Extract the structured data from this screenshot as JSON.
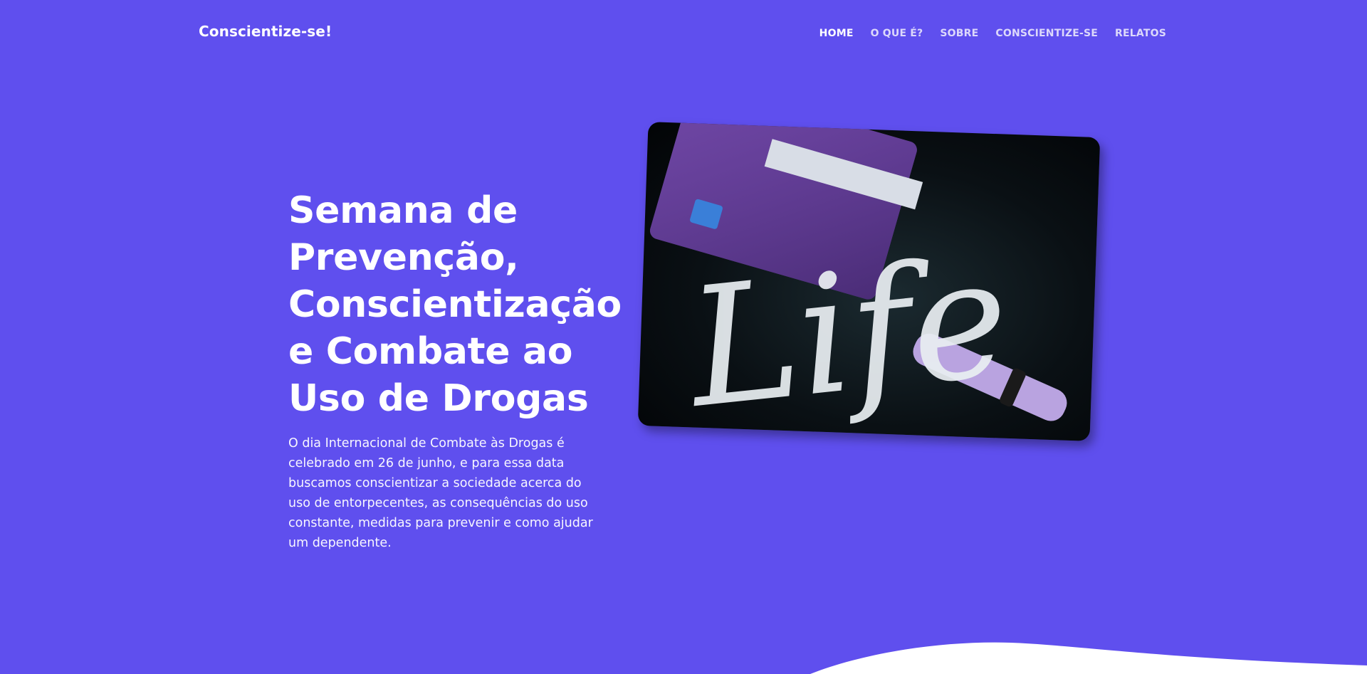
{
  "brand": "Conscientize-se!",
  "nav": {
    "items": [
      {
        "label": "HOME",
        "active": true
      },
      {
        "label": "O QUE É?",
        "active": false
      },
      {
        "label": "SOBRE",
        "active": false
      },
      {
        "label": "CONSCIENTIZE-SE",
        "active": false
      },
      {
        "label": "RELATOS",
        "active": false
      }
    ]
  },
  "hero": {
    "title": "Semana de Prevenção, Conscientização e Combate ao Uso de Drogas",
    "text": "O dia Internacional de Combate às Drogas é celebrado em 26 de junho, e para essa data buscamos conscientizar a sociedade acerca do uso de entorpecentes, as consequências do uso constante, medidas para prevenir e como ajudar um dependente.",
    "image_word": "Life"
  },
  "colors": {
    "background": "#5f4fee",
    "text": "#ffffff",
    "wave": "#ffffff"
  }
}
